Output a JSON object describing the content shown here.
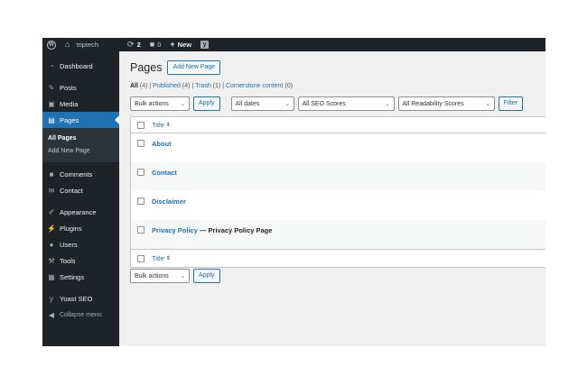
{
  "adminbar": {
    "site_name": "triptech",
    "updates_count": "2",
    "comments_count": "0",
    "new_label": "New"
  },
  "sidebar": {
    "items": [
      {
        "label": "Dashboard",
        "icon": "dashboard-icon"
      },
      {
        "label": "Posts",
        "icon": "pin-icon"
      },
      {
        "label": "Media",
        "icon": "media-icon"
      },
      {
        "label": "Pages",
        "icon": "pages-icon"
      },
      {
        "label": "Comments",
        "icon": "comment-icon"
      },
      {
        "label": "Contact",
        "icon": "mail-icon"
      },
      {
        "label": "Appearance",
        "icon": "brush-icon"
      },
      {
        "label": "Plugins",
        "icon": "plugin-icon"
      },
      {
        "label": "Users",
        "icon": "user-icon"
      },
      {
        "label": "Tools",
        "icon": "wrench-icon"
      },
      {
        "label": "Settings",
        "icon": "settings-icon"
      },
      {
        "label": "Yoast SEO",
        "icon": "yoast-icon"
      },
      {
        "label": "Collapse menu",
        "icon": "collapse-icon"
      }
    ],
    "submenu": [
      "All Pages",
      "Add New Page"
    ]
  },
  "main": {
    "title": "Pages",
    "add_new_label": "Add New Page",
    "filters": {
      "all": "All",
      "all_count": "(4)",
      "published": "Published",
      "published_count": "(4)",
      "trash": "Trash",
      "trash_count": "(1)",
      "cornerstone": "Cornerstone content",
      "cornerstone_count": "(0)",
      "sep": "|"
    },
    "bulk_actions": "Bulk actions",
    "apply_label": "Apply",
    "all_dates": "All dates",
    "seo_scores": "All SEO Scores",
    "readability_scores": "All Readability Scores",
    "filter_label": "Filter",
    "column_title": "Title",
    "rows": [
      {
        "title": "About",
        "state": ""
      },
      {
        "title": "Contact",
        "state": ""
      },
      {
        "title": "Disclaimer",
        "state": ""
      },
      {
        "title": "Privacy Policy",
        "state": " — Privacy Policy Page"
      }
    ]
  },
  "colors": {
    "accent": "#2271b1",
    "sidebar_bg": "#1d2327",
    "content_bg": "#f0f0f1"
  }
}
